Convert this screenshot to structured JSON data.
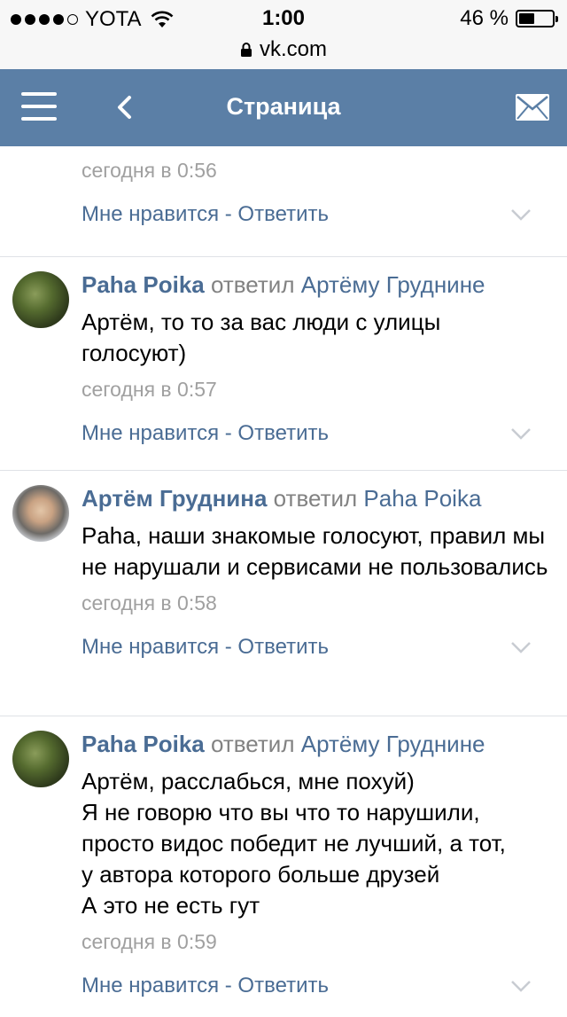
{
  "status_bar": {
    "carrier": "YOTA",
    "time": "1:00",
    "battery": "46 %",
    "battery_level": 0.46
  },
  "url_bar": {
    "url": "vk.com"
  },
  "header": {
    "title": "Страница"
  },
  "top_item": {
    "time": "сегодня в 0:56",
    "like": "Мне нравится",
    "separator": " - ",
    "reply": "Ответить"
  },
  "comments": [
    {
      "author": "Paha Poika",
      "replied": "ответил",
      "target": "Артёму Груднине",
      "text": "Артём, то то за вас люди с улицы голосуют)",
      "time": "сегодня в 0:57",
      "like": "Мне нравится",
      "separator": " - ",
      "reply": "Ответить"
    },
    {
      "author": "Артём Груднина",
      "replied": "ответил",
      "target": "Paha Poika",
      "text": "Paha, наши знакомые голосуют, правил мы не нарушали и сервисами не пользовались",
      "time": "сегодня в 0:58",
      "like": "Мне нравится",
      "separator": " - ",
      "reply": "Ответить"
    },
    {
      "author": "Paha Poika",
      "replied": "ответил",
      "target": "Артёму Груднине",
      "text_lines": [
        "Артём, расслабься, мне похуй)",
        "Я не говорю что вы что то нарушили,",
        "просто видос победит не лучший, а тот,",
        "у автора которого больше друзей",
        "А это не есть гут"
      ],
      "time": "сегодня в 0:59",
      "like": "Мне нравится",
      "separator": " - ",
      "reply": "Ответить"
    }
  ],
  "colors": {
    "header_bg": "#5b7fa6",
    "link": "#4a6c94",
    "muted": "#a0a0a0"
  }
}
